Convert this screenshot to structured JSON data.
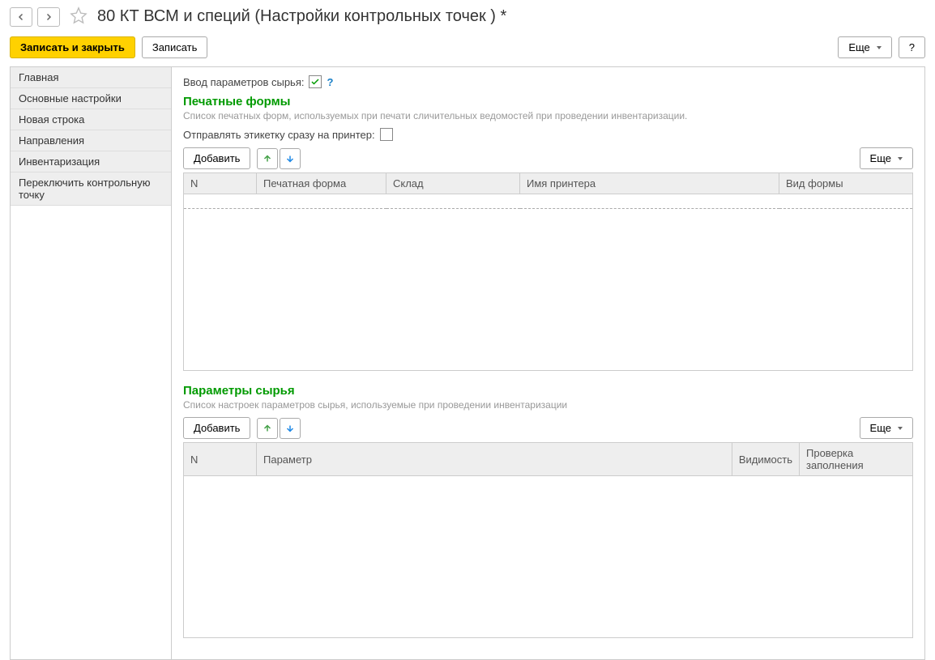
{
  "header": {
    "title": "80 КТ ВСМ и специй (Настройки контрольных точек ) *"
  },
  "actions": {
    "save_close": "Записать и закрыть",
    "save": "Записать",
    "more": "Еще",
    "help": "?"
  },
  "sidebar": {
    "items": [
      {
        "label": "Главная"
      },
      {
        "label": "Основные настройки"
      },
      {
        "label": "Новая строка"
      },
      {
        "label": "Направления"
      },
      {
        "label": "Инвентаризация"
      },
      {
        "label": "Переключить контрольную точку"
      }
    ]
  },
  "main": {
    "raw_params": {
      "label": "Ввод параметров сырья:",
      "checked": true
    },
    "section_print": {
      "title": "Печатные формы",
      "desc": "Список печатных форм, используемых при печати сличительных ведомостей при проведении инвентаризации.",
      "send_label_direct": {
        "label": "Отправлять этикетку сразу на принтер:",
        "checked": false
      },
      "add": "Добавить",
      "more": "Еще",
      "columns": {
        "n": "N",
        "form": "Печатная форма",
        "store": "Склад",
        "printer": "Имя принтера",
        "kind": "Вид формы"
      }
    },
    "section_params": {
      "title": "Параметры сырья",
      "desc": "Список настроек параметров сырья, используемые при проведении инвентаризации",
      "add": "Добавить",
      "more": "Еще",
      "columns": {
        "n": "N",
        "param": "Параметр",
        "visibility": "Видимость",
        "check": "Проверка заполнения"
      }
    }
  }
}
